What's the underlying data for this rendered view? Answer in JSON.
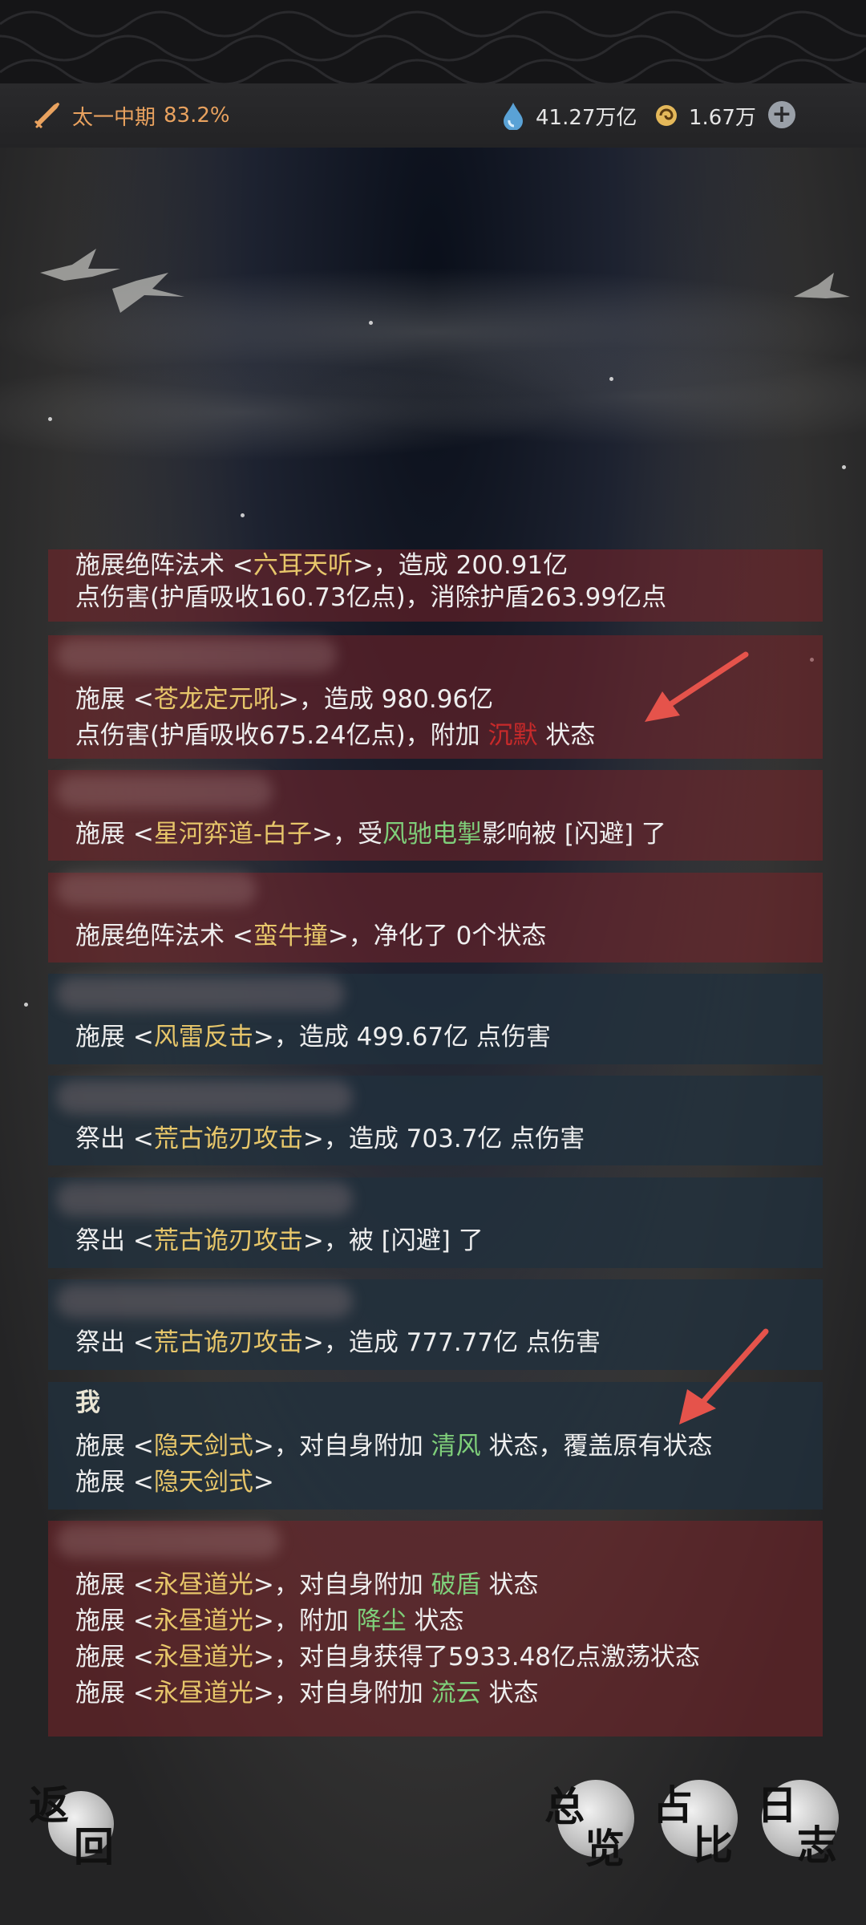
{
  "header": {
    "realm_label": "太一中期",
    "realm_progress": "83.2%",
    "currency_a": "41.27万亿",
    "currency_b": "1.67万"
  },
  "icons": {
    "realm": "sword-icon",
    "currency_a": "spirit-drop-icon",
    "currency_b": "swirl-coin-icon",
    "add": "plus-icon"
  },
  "colors": {
    "skill": "#e7c66a",
    "status_buff": "#7fcf7a",
    "status_silence": "#c82a2a",
    "enemy_entry_bg": "#782228",
    "ally_entry_bg": "#20303e"
  },
  "log": {
    "entries": [
      {
        "lines": [
          [
            "施展绝阵法术 <",
            "六耳天听",
            ">，造成 200.91亿"
          ],
          [
            "点伤害(护盾吸收160.73亿点)，消除护盾263.99亿点"
          ]
        ]
      },
      {
        "lines": [
          [
            "施展 <",
            "苍龙定元吼",
            ">，造成 980.96亿"
          ],
          [
            "点伤害(护盾吸收675.24亿点)，附加 ",
            "沉默",
            " 状态"
          ]
        ]
      },
      {
        "lines": [
          [
            "施展 <",
            "星河弈道-白子",
            ">，受",
            "风驰电掣",
            "影响被 [闪避] 了"
          ]
        ]
      },
      {
        "lines": [
          [
            "施展绝阵法术 <",
            "蛮牛撞",
            ">，净化了 0个状态"
          ]
        ]
      },
      {
        "lines": [
          [
            "施展 <",
            "风雷反击",
            ">，造成 499.67亿 点伤害"
          ]
        ]
      },
      {
        "lines": [
          [
            "祭出 <",
            "荒古诡刃攻击",
            ">，造成 703.7亿 点伤害"
          ]
        ]
      },
      {
        "lines": [
          [
            "祭出 <",
            "荒古诡刃攻击",
            ">，被 [闪避] 了"
          ]
        ]
      },
      {
        "lines": [
          [
            "祭出 <",
            "荒古诡刃攻击",
            ">，造成 777.77亿 点伤害"
          ]
        ]
      },
      {
        "actor": "我",
        "lines": [
          [
            "施展 <",
            "隐天剑式",
            ">，对自身附加 ",
            "清风",
            " 状态，覆盖原有状态"
          ],
          [
            "施展 <",
            "隐天剑式",
            ">"
          ]
        ]
      },
      {
        "lines": [
          [
            "施展 <",
            "永昼道光",
            ">，对自身附加 ",
            "破盾",
            " 状态"
          ],
          [
            "施展 <",
            "永昼道光",
            ">，附加 ",
            "降尘",
            " 状态"
          ],
          [
            "施展 <",
            "永昼道光",
            ">，对自身获得了5933.48亿点激荡状态"
          ],
          [
            "施展 <",
            "永昼道光",
            ">，对自身附加 ",
            "流云",
            " 状态"
          ]
        ]
      }
    ]
  },
  "nav": {
    "back": [
      "返",
      "回"
    ],
    "overview": [
      "总",
      "览"
    ],
    "ratio": [
      "占",
      "比"
    ],
    "log": [
      "日",
      "志"
    ]
  }
}
